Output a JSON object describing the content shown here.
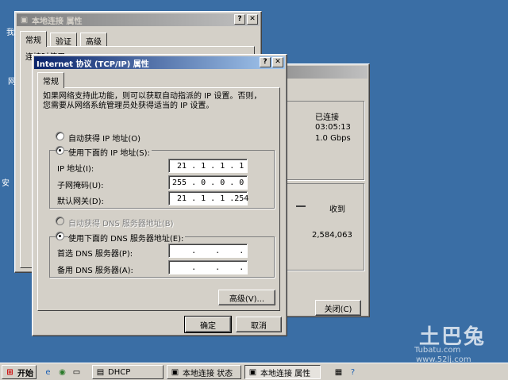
{
  "desktop": {
    "labels": [
      "我",
      "网",
      "安"
    ]
  },
  "back_window": {
    "title": "本地连接 属性",
    "tabs": [
      "常规",
      "验证",
      "高级"
    ],
    "partial_text": "连接时使用:"
  },
  "status_window": {
    "status_value": "已连接",
    "duration_value": "03:05:13",
    "speed_value": "1.0 Gbps",
    "received_header": "收到",
    "received_value": "2,584,063",
    "close_button": "关闭(C)"
  },
  "tcpip_dialog": {
    "title": "Internet 协议 (TCP/IP) 属性",
    "tab": "常规",
    "description": "如果网络支持此功能，则可以获取自动指派的 IP 设置。否则，\n您需要从网络系统管理员处获得适当的 IP 设置。",
    "auto_ip_label": "自动获得 IP 地址(O)",
    "use_ip_label": "使用下面的 IP 地址(S):",
    "ip_address_label": "IP 地址(I):",
    "ip_address_value": " 21 . 1 . 1 . 1",
    "subnet_label": "子网掩码(U):",
    "subnet_value": "255 . 0 . 0 . 0",
    "gateway_label": "默认网关(D):",
    "gateway_value": " 21 . 1 . 1 .254",
    "auto_dns_label": "自动获得 DNS 服务器地址(B)",
    "use_dns_label": "使用下面的 DNS 服务器地址(E):",
    "preferred_dns_label": "首选 DNS 服务器(P):",
    "preferred_dns_value": "    .    .    .",
    "alternate_dns_label": "备用 DNS 服务器(A):",
    "alternate_dns_value": "    .    .    .",
    "advanced_button": "高级(V)...",
    "ok_button": "确定",
    "cancel_button": "取消"
  },
  "taskbar": {
    "start": "开始",
    "tasks": [
      "DHCP",
      "本地连接 状态",
      "本地连接 属性"
    ]
  },
  "watermark": {
    "brand": "土巴兔",
    "sub": "Tubatu.com",
    "url": "www.52lj.com"
  }
}
